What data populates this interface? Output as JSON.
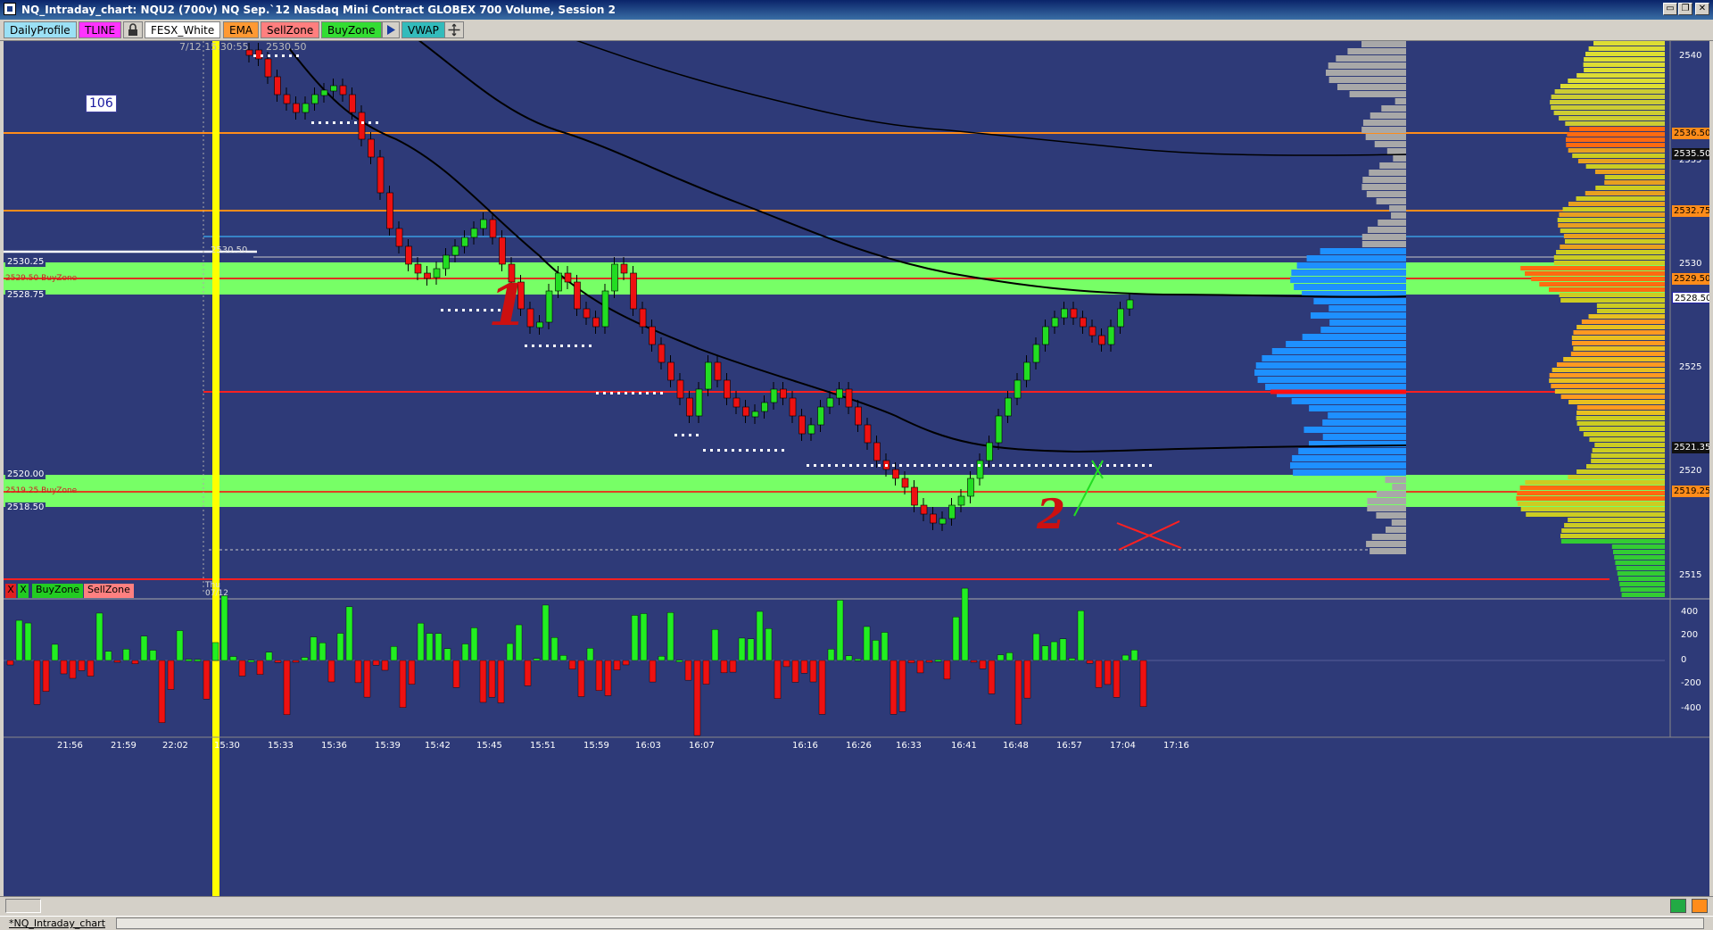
{
  "window": {
    "title": "NQ_Intraday_chart: NQU2 (700v) NQ Sep.`12 Nasdaq Mini Contract GLOBEX 700 Volume, Session 2",
    "restore_glyph": "▭",
    "maximize_glyph": "❐",
    "close_glyph": "✕"
  },
  "toolbar": {
    "daily_profile": "DailyProfile",
    "tline": "TLINE",
    "fesx_white": "FESX_White",
    "ema": "EMA",
    "sell_zone": "SellZone",
    "buy_zone": "BuyZone",
    "vwap": "VWAP",
    "colors": {
      "daily_profile": "#9be0f5",
      "tline": "#ff33ff",
      "ema": "#ff9933",
      "sell_zone": "#ff7f7f",
      "buy_zone": "#33dd33",
      "vwap": "#33bbbb"
    }
  },
  "chart": {
    "session_label": "7/12 15:30:55",
    "session_price": "2530.50",
    "bar_count": "106",
    "ref_line_label": "2530.50",
    "day_label_1": "Thu",
    "day_label_2": "07/12",
    "annotation_1": "1",
    "annotation_2": "2",
    "zones": [
      {
        "top_label": "2530.25",
        "mid_label": "2529.50 BuyZone",
        "bottom_label": "2528.75"
      },
      {
        "top_label": "2520.00",
        "mid_label": "2519.25 BuyZone",
        "bottom_label": "2518.50"
      }
    ],
    "price_tags": [
      "2536.50",
      "2535.50",
      "2532.75",
      "2529.50",
      "2528.50",
      "2521.35",
      "2519.25"
    ],
    "price_axis": [
      "2540",
      "2535",
      "2530",
      "2525",
      "2520",
      "2515"
    ],
    "indicator_axis": [
      "400",
      "200",
      "0",
      "-200",
      "-400"
    ],
    "time_axis": [
      "21:56",
      "21:59",
      "22:02",
      "15:30",
      "15:33",
      "15:36",
      "15:39",
      "15:42",
      "15:45",
      "15:51",
      "15:59",
      "16:03",
      "16:07",
      "16:16",
      "16:26",
      "16:33",
      "16:41",
      "16:48",
      "16:57",
      "17:04",
      "17:16"
    ],
    "zone_toolbar": {
      "x1": "X",
      "x2": "X",
      "buy": "BuyZone",
      "sell": "SellZone"
    }
  },
  "statusbar": {
    "tab": "*NQ_Intraday_chart"
  }
}
